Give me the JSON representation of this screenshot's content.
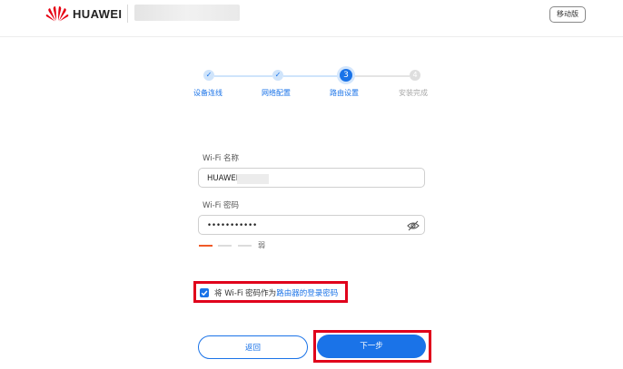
{
  "header": {
    "brand": "HUAWEI",
    "mobile_label": "移动版"
  },
  "steps": [
    {
      "label": "设备连线",
      "state": "done",
      "marker": "✓"
    },
    {
      "label": "网络配置",
      "state": "done",
      "marker": "✓"
    },
    {
      "label": "路由设置",
      "state": "current",
      "marker": "3"
    },
    {
      "label": "安装完成",
      "state": "todo",
      "marker": "4"
    }
  ],
  "form": {
    "ssid_label": "Wi-Fi 名称",
    "ssid_value": "HUAWEI",
    "password_label": "Wi-Fi 密码",
    "password_value": "•••••••••••",
    "strength_label": "弱"
  },
  "checkbox": {
    "checked": true,
    "text_prefix": "将 Wi-Fi 密码作为",
    "text_link": "路由器的登录密码"
  },
  "buttons": {
    "back": "返回",
    "next": "下一步"
  },
  "colors": {
    "accent": "#1a73e8",
    "highlight": "#e0001b",
    "strength_weak": "#f05a28"
  }
}
